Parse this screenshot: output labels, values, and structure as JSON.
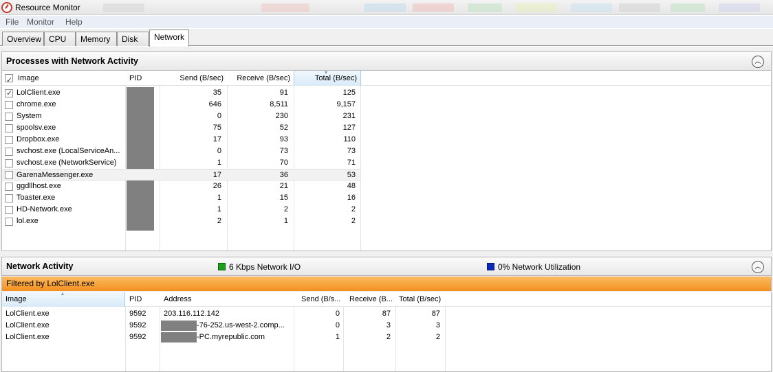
{
  "window": {
    "title": "Resource Monitor"
  },
  "menu": [
    "File",
    "Monitor",
    "Help"
  ],
  "tabs": [
    "Overview",
    "CPU",
    "Memory",
    "Disk",
    "Network"
  ],
  "active_tab": "Network",
  "processes": {
    "title": "Processes with Network Activity",
    "headers": {
      "image": "Image",
      "pid": "PID",
      "send": "Send (B/sec)",
      "receive": "Receive (B/sec)",
      "total": "Total (B/sec)"
    },
    "rows": [
      {
        "image": "LolClient.exe",
        "send": "35",
        "receive": "91",
        "total": "125",
        "checked": true
      },
      {
        "image": "chrome.exe",
        "send": "646",
        "receive": "8,511",
        "total": "9,157",
        "checked": false
      },
      {
        "image": "System",
        "send": "0",
        "receive": "230",
        "total": "231",
        "checked": false
      },
      {
        "image": "spoolsv.exe",
        "send": "75",
        "receive": "52",
        "total": "127",
        "checked": false
      },
      {
        "image": "Dropbox.exe",
        "send": "17",
        "receive": "93",
        "total": "110",
        "checked": false
      },
      {
        "image": "svchost.exe (LocalServiceAn...",
        "send": "0",
        "receive": "73",
        "total": "73",
        "checked": false
      },
      {
        "image": "svchost.exe (NetworkService)",
        "send": "1",
        "receive": "70",
        "total": "71",
        "checked": false
      },
      {
        "image": "GarenaMessenger.exe",
        "send": "17",
        "receive": "36",
        "total": "53",
        "checked": false
      },
      {
        "image": "ggdllhost.exe",
        "send": "26",
        "receive": "21",
        "total": "48",
        "checked": false
      },
      {
        "image": "Toaster.exe",
        "send": "1",
        "receive": "15",
        "total": "16",
        "checked": false
      },
      {
        "image": "HD-Network.exe",
        "send": "1",
        "receive": "2",
        "total": "2",
        "checked": false
      },
      {
        "image": "lol.exe",
        "send": "2",
        "receive": "1",
        "total": "2",
        "checked": false
      }
    ]
  },
  "network_activity": {
    "title": "Network Activity",
    "io_label": "6 Kbps Network I/O",
    "utilization_label": "0% Network Utilization",
    "io_color": "#1aa31a",
    "utilization_color": "#0a2bb8",
    "filter": "Filtered by LolClient.exe",
    "headers": {
      "image": "Image",
      "pid": "PID",
      "address": "Address",
      "send": "Send (B/s...",
      "receive": "Receive (B...",
      "total": "Total (B/sec)"
    },
    "rows": [
      {
        "image": "LolClient.exe",
        "pid": "9592",
        "address": "203.116.112.142",
        "send": "0",
        "receive": "87",
        "total": "87"
      },
      {
        "image": "LolClient.exe",
        "pid": "9592",
        "address": "-76-252.us-west-2.comp...",
        "send": "0",
        "receive": "3",
        "total": "3"
      },
      {
        "image": "LolClient.exe",
        "pid": "9592",
        "address": "-PC.myrepublic.com",
        "send": "1",
        "receive": "2",
        "total": "2"
      }
    ]
  }
}
